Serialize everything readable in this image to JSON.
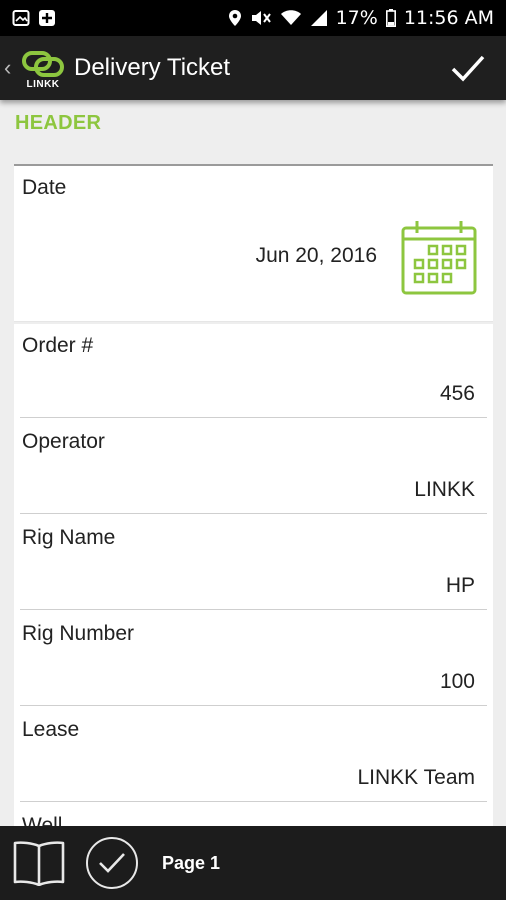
{
  "status_bar": {
    "battery": "17%",
    "time": "11:56 AM"
  },
  "app_bar": {
    "logo_text": "LINKK",
    "title": "Delivery Ticket"
  },
  "section": {
    "title": "HEADER"
  },
  "form": {
    "date": {
      "label": "Date",
      "value": "Jun 20, 2016"
    },
    "fields": [
      {
        "label": "Order #",
        "value": "456"
      },
      {
        "label": "Operator",
        "value": "LINKK"
      },
      {
        "label": "Rig Name",
        "value": "HP"
      },
      {
        "label": "Rig Number",
        "value": "100"
      },
      {
        "label": "Lease",
        "value": "LINKK Team"
      },
      {
        "label": "Well",
        "value": ""
      }
    ]
  },
  "bottom_bar": {
    "page_label": "Page 1"
  },
  "colors": {
    "accent": "#8dc63f",
    "app_bar_bg": "#1f1f1f",
    "status_bar_bg": "#000000"
  }
}
